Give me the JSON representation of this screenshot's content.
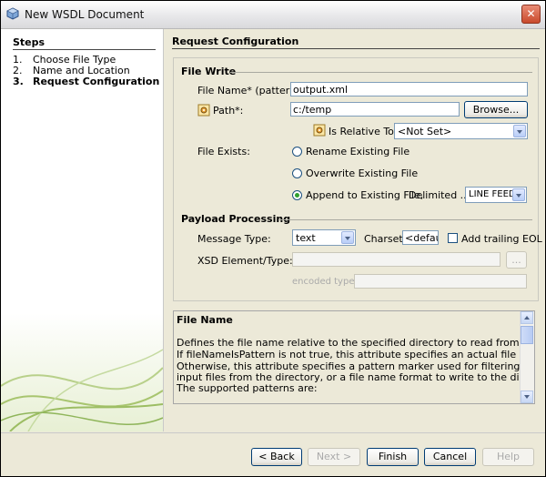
{
  "window": {
    "title": "New WSDL Document"
  },
  "steps": {
    "header": "Steps",
    "items": [
      {
        "num": "1.",
        "label": "Choose File Type"
      },
      {
        "num": "2.",
        "label": "Name and Location"
      },
      {
        "num": "3.",
        "label": "Request Configuration"
      }
    ]
  },
  "content": {
    "header": "Request Configuration",
    "file_write": {
      "section": "File Write",
      "file_name_label": "File Name* (pattern):",
      "file_name_value": "output.xml",
      "path_label": "Path*:",
      "path_value": "c:/temp",
      "browse_label": "Browse...",
      "relative_label": "Is Relative To:",
      "relative_value": "<Not Set>",
      "exists_label": "File Exists:",
      "opt_rename": "Rename Existing File",
      "opt_overwrite": "Overwrite Existing File",
      "opt_append": "Append to Existing File,",
      "delimited_label": "Delimited ...",
      "delimited_value": "LINE FEED",
      "selected_option": "append"
    },
    "payload": {
      "section": "Payload Processing",
      "message_type_label": "Message Type:",
      "message_type_value": "text",
      "charset_label": "Charset:",
      "charset_value": "<default",
      "trailing_eol_label": "Add trailing EOL",
      "trailing_eol_checked": false,
      "xsd_label": "XSD Element/Type:",
      "xsd_value": "",
      "xsd_browse_label": "...",
      "encoded_label": "encoded type:",
      "encoded_value": ""
    },
    "help": {
      "title": "File Name",
      "lines": [
        "Defines the file name relative to the specified directory to read from or write to.",
        "If fileNameIsPattern is not true, this attribute specifies an actual file name.",
        "Otherwise, this attribute specifies a pattern marker used for filtering",
        "input files from the directory, or a file name format to write to the directory;",
        "The supported patterns are:"
      ]
    }
  },
  "buttons": {
    "back": "< Back",
    "next": "Next >",
    "finish": "Finish",
    "cancel": "Cancel",
    "help": "Help"
  }
}
